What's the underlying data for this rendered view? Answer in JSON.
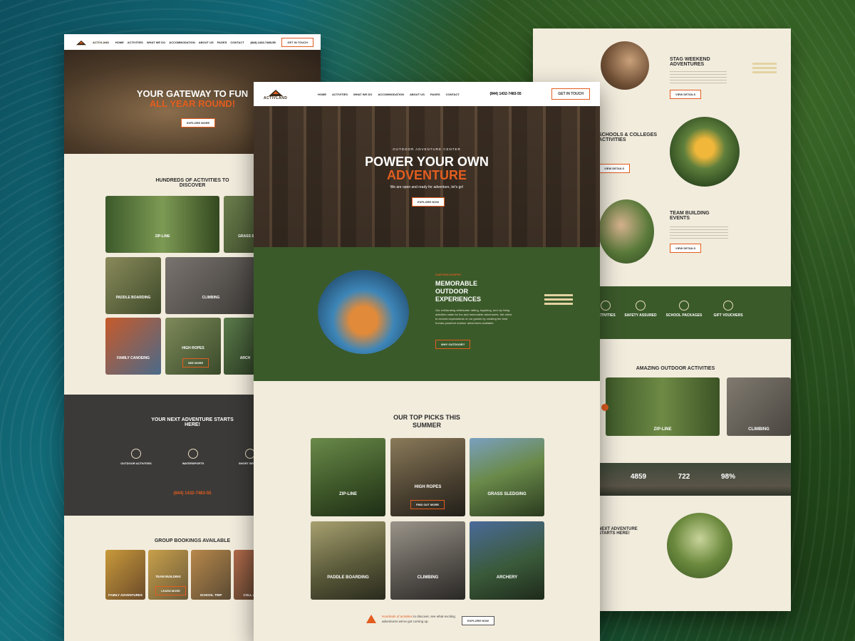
{
  "brand": {
    "logo_text": "ACTIVLAND"
  },
  "left": {
    "nav": [
      "HOME",
      "ACTIVITIES",
      "WHAT WE DO",
      "ACCOMMODATION",
      "ABOUT US",
      "PAGES",
      "CONTACT"
    ],
    "phone": "(844) 1432-7483-55",
    "cta": "GET IN TOUCH",
    "hero_title_1": "YOUR GATEWAY TO FUN",
    "hero_title_2": "ALL YEAR ROUND!",
    "hero_btn": "EXPLORE MORE",
    "section1": "HUNDREDS OF ACTIVITIES TO DISCOVER",
    "tiles": [
      "ZIP-LINE",
      "GRASS SLEDGE",
      "PADDLE BOARDING",
      "CLIMBING",
      "FAMILY CANOEING",
      "HIGH ROPES",
      "ARCH"
    ],
    "tile_btn": "SEE MORE",
    "dark_title": "YOUR NEXT ADVENTURE STARTS HERE!",
    "features": [
      "OUTDOOR ACTIVITIES",
      "WATERSPORTS",
      "SHORT BREAKS"
    ],
    "dark_phone": "(844) 1432-7483-55",
    "group_title": "GROUP BOOKINGS AVAILABLE",
    "groups": [
      "FAMILY ADVENTURES",
      "TEAM BUILDING",
      "SCHOOL TRIP",
      "COLL ADVEN"
    ],
    "group_btn": "LEARN MORE"
  },
  "center": {
    "nav": [
      "HOME",
      "ACTIVITIES",
      "WHAT WE DO",
      "ACCOMMODATION",
      "ABOUT US",
      "PAGES",
      "CONTACT"
    ],
    "phone": "(844) 1432-7483-55",
    "cta": "GET IN TOUCH",
    "hero_kicker": "OUTDOOR ADVENTURE CENTER",
    "hero_title_1": "POWER YOUR OWN",
    "hero_title_2": "ADVENTURE",
    "hero_sub": "We are open and ready for adventure, let's go!",
    "hero_btn": "EXPLORE NOW",
    "green_kicker": "OUR PHILOSOPHY",
    "green_title": "MEMORABLE OUTDOOR EXPERIENCES",
    "green_text": "Our exhilarating whitewater rafting, kayaking, and zip lining activities make for fun and memorable adventures. We strive to exceed expectations of our guests by creating the best human-powered outdoor adventures available.",
    "green_btn": "WHY OUTDOOR?",
    "picks_title": "OUR TOP PICKS THIS SUMMER",
    "cards": [
      "ZIP-LINE",
      "HIGH ROPES",
      "GRASS SLEDGING",
      "PADDLE BOARDING",
      "CLIMBING",
      "ARCHERY"
    ],
    "card_btn": "FIND OUT MORE",
    "bottom_link": "Hundreds of activities",
    "bottom_text": "to discover, see what exciting adventures we've got coming up.",
    "bottom_btn": "EXPLORE NOW"
  },
  "right": {
    "stag_title": "STAG WEEKEND ADVENTURES",
    "school_title": "SCHOOLS & COLLEGES ACTIVITIES",
    "team_title": "TEAM BUILDING EVENTS",
    "view_btn": "VIEW DETAILS",
    "features": [
      "ACTIVITIES",
      "SAFETY ASSURED",
      "SCHOOL PACKAGES",
      "GIFT VOUCHERS"
    ],
    "amazing_title": "AMAZING OUTDOOR ACTIVITIES",
    "slides": [
      "ZIP-LINE",
      "CLIMBING"
    ],
    "stats": [
      "4859",
      "722",
      "98%"
    ],
    "next_title": "NEXT ADVENTURE STARTS HERE!"
  },
  "colors": {
    "accent": "#e35d1f",
    "green": "#3b5a2a",
    "cream": "#f2ecdd",
    "dark": "#3b3a38"
  }
}
